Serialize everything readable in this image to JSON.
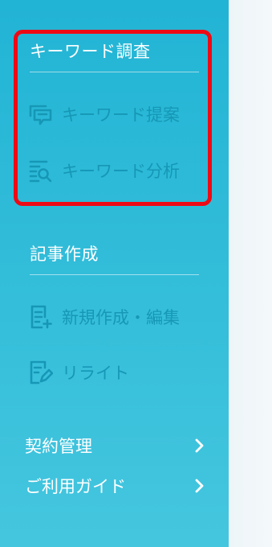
{
  "sidebar": {
    "keyword_section": {
      "title": "キーワード調査",
      "items": [
        {
          "label": "キーワード提案",
          "icon": "keyword-suggest-icon"
        },
        {
          "label": "キーワード分析",
          "icon": "keyword-analysis-icon"
        }
      ]
    },
    "article_section": {
      "title": "記事作成",
      "items": [
        {
          "label": "新規作成・編集",
          "icon": "new-article-icon"
        },
        {
          "label": "リライト",
          "icon": "rewrite-icon"
        }
      ]
    },
    "links": [
      {
        "label": "契約管理",
        "icon": "chevron-right-icon"
      },
      {
        "label": "ご利用ガイド",
        "icon": "chevron-right-icon"
      }
    ]
  },
  "colors": {
    "sidebar_gradient_top": "#22b4d5",
    "sidebar_gradient_bottom": "#45c6df",
    "nav_item_text": "#1697b6",
    "section_title_text": "#ffffff",
    "highlight_outline": "#ee0a14"
  }
}
